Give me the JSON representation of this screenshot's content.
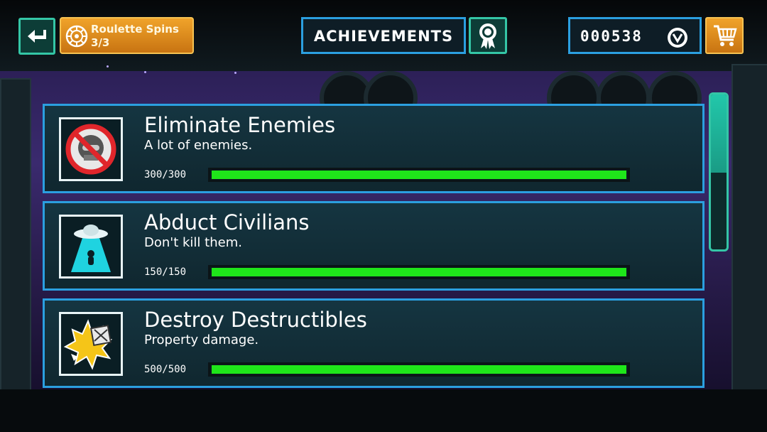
{
  "topbar": {
    "roulette_label": "Roulette Spins",
    "roulette_count": "3/3",
    "screen_title": "ACHIEVEMENTS",
    "coins": "000538"
  },
  "achievements": [
    {
      "title": "Eliminate Enemies",
      "description": "A lot of enemies.",
      "progress_text": "300/300",
      "progress": 1.0,
      "icon": "no-enemies-icon"
    },
    {
      "title": "Abduct Civilians",
      "description": "Don't kill them.",
      "progress_text": "150/150",
      "progress": 1.0,
      "icon": "ufo-abduction-icon"
    },
    {
      "title": "Destroy Destructibles",
      "description": "Property damage.",
      "progress_text": "500/500",
      "progress": 1.0,
      "icon": "explosion-crate-icon"
    }
  ],
  "scroll_position": 0.0,
  "colors": {
    "accent_blue": "#2b9fe0",
    "accent_teal": "#34c6a6",
    "orange": "#f0a32a",
    "progress_green": "#1fe51a"
  }
}
